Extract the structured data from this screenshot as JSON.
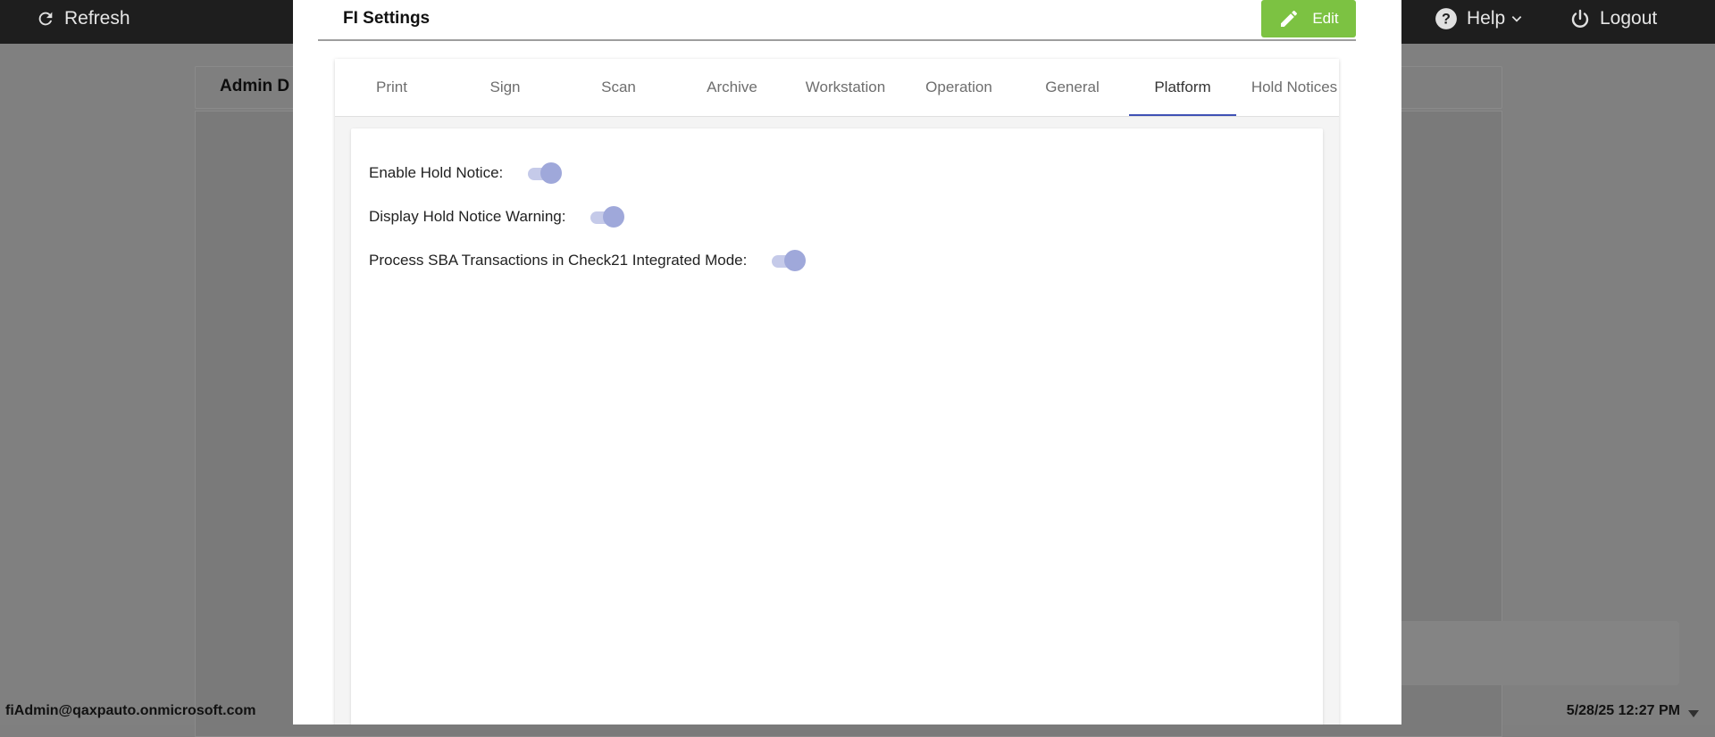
{
  "topbar": {
    "refresh_label": "Refresh",
    "help_label": "Help",
    "logout_label": "Logout"
  },
  "background": {
    "panel_title": "Admin D",
    "footer_user": "fiAdmin@qaxpauto.onmicrosoft.com",
    "footer_datetime": "5/28/25 12:27 PM"
  },
  "modal": {
    "title": "FI Settings",
    "edit_label": "Edit",
    "tabs": [
      {
        "label": "Print"
      },
      {
        "label": "Sign"
      },
      {
        "label": "Scan"
      },
      {
        "label": "Archive"
      },
      {
        "label": "Workstation"
      },
      {
        "label": "Operation"
      },
      {
        "label": "General"
      },
      {
        "label": "Platform",
        "active": true
      },
      {
        "label": "Hold Notices"
      }
    ],
    "settings": [
      {
        "label": "Enable Hold Notice:",
        "enabled": true
      },
      {
        "label": "Display Hold Notice Warning:",
        "enabled": true
      },
      {
        "label": "Process SBA Transactions in Check21 Integrated Mode:",
        "enabled": true
      }
    ]
  },
  "colors": {
    "edit_button": "#7cc242",
    "tab_indicator": "#3f51b5",
    "toggle_knob": "#9fa8da",
    "toggle_track": "#c5cae9",
    "topbar": "#1e1e1e"
  },
  "icons": {
    "refresh": "refresh-icon",
    "help": "help-circle-icon",
    "logout": "power-icon",
    "edit": "pencil-icon"
  }
}
